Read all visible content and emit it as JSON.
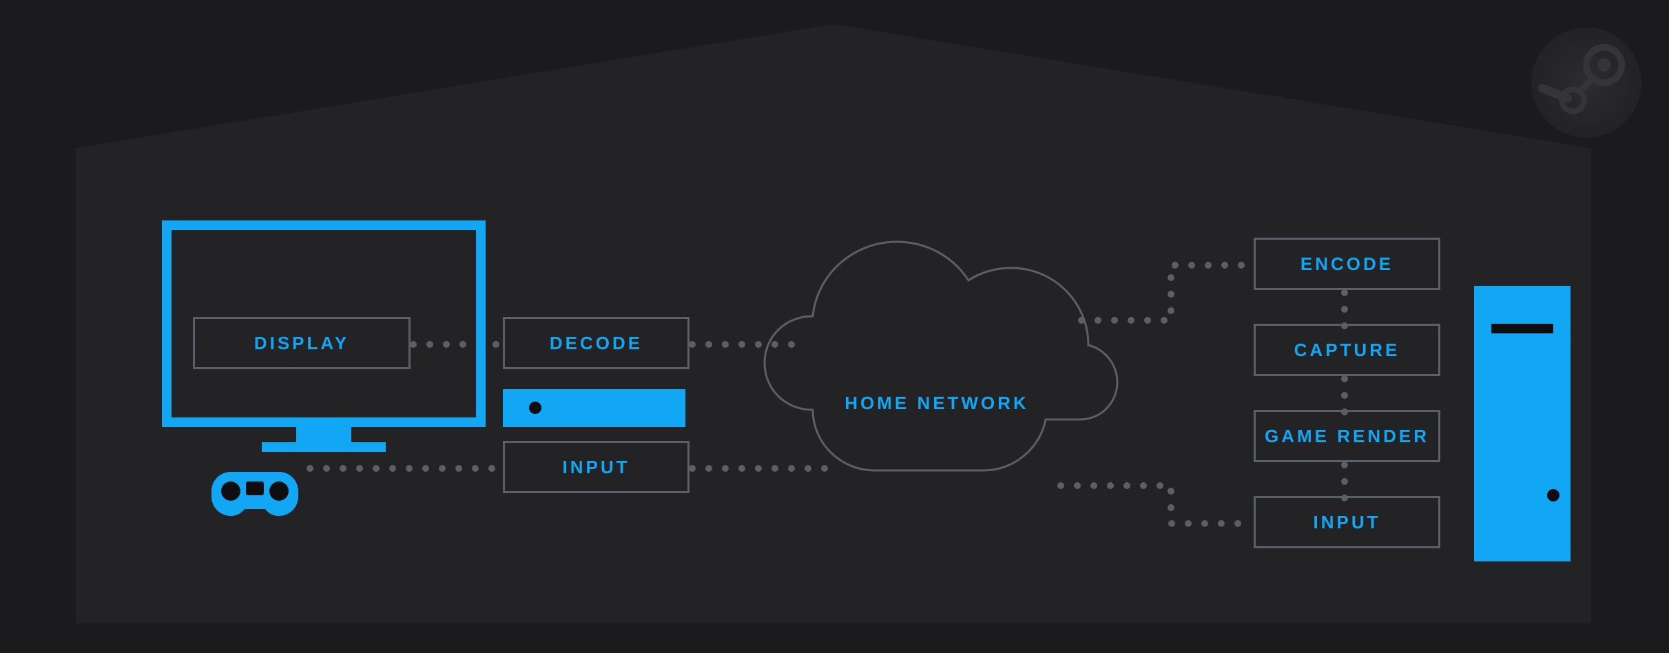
{
  "colors": {
    "background": "#1b1b1e",
    "panel": "#232326",
    "line": "#5d5f66",
    "accent": "#11a7f4"
  },
  "logo": {
    "name": "steam-icon"
  },
  "tv": {
    "display_label": "DISPLAY"
  },
  "client": {
    "decode_label": "DECODE",
    "input_label": "INPUT"
  },
  "network": {
    "label": "HOME NETWORK"
  },
  "host": {
    "encode_label": "ENCODE",
    "capture_label": "CAPTURE",
    "render_label": "GAME RENDER",
    "input_label": "INPUT"
  },
  "flow_description": "Client side DISPLAY receives DECODE output; controller sends INPUT; both traverse HOME NETWORK cloud to host PC which runs INPUT → GAME RENDER → CAPTURE → ENCODE and streams back."
}
